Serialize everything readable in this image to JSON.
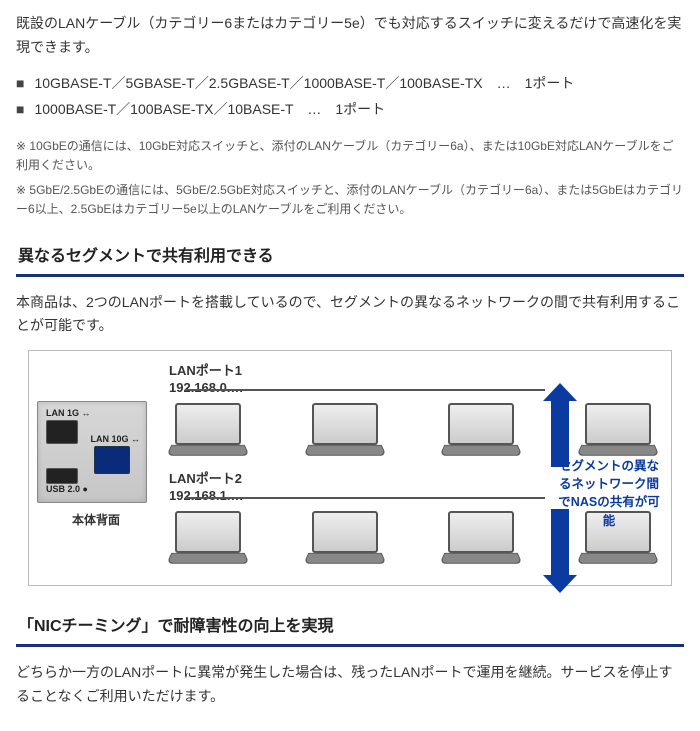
{
  "intro": {
    "lead1": "既設のLANケーブル（カテゴリー6またはカテゴリー5e）でも対応するスイッチに変えるだけで高速化を実現できます。"
  },
  "specs": {
    "items": [
      "10GBASE-T／5GBASE-T／2.5GBASE-T／1000BASE-T／100BASE-TX　…　1ポート",
      "1000BASE-T／100BASE-TX／10BASE-T　…　1ポート"
    ]
  },
  "notes": {
    "n1": "※ 10GbEの通信には、10GbE対応スイッチと、添付のLANケーブル（カテゴリー6a）、または10GbE対応LANケーブルをご利用ください。",
    "n2": "※ 5GbE/2.5GbEの通信には、5GbE/2.5GbE対応スイッチと、添付のLANケーブル（カテゴリー6a）、または5GbEはカテゴリー6以上、2.5GbEはカテゴリー5e以上のLANケーブルをご利用ください。"
  },
  "sections": {
    "segment_title": "異なるセグメントで共有利用できる",
    "segment_body": "本商品は、2つのLANポートを搭載しているので、セグメントの異なるネットワークの間で共有利用することが可能です。",
    "teaming_title": "「NICチーミング」で耐障害性の向上を実現",
    "teaming_body": "どちらか一方のLANポートに異常が発生した場合は、残ったLANポートで運用を継続。サービスを停止することなくご利用いただけます。"
  },
  "diagram": {
    "panel": {
      "lan1g": "LAN 1G ↔",
      "lan10g": "LAN 10G ↔",
      "usb": "USB 2.0 ●",
      "caption": "本体背面"
    },
    "port1": {
      "title": "LANポート1",
      "ip": "192.168.0.…"
    },
    "port2": {
      "title": "LANポート2",
      "ip": "192.168.1.…"
    },
    "callout": "セグメントの異なるネットワーク間でNASの共有が可能"
  }
}
